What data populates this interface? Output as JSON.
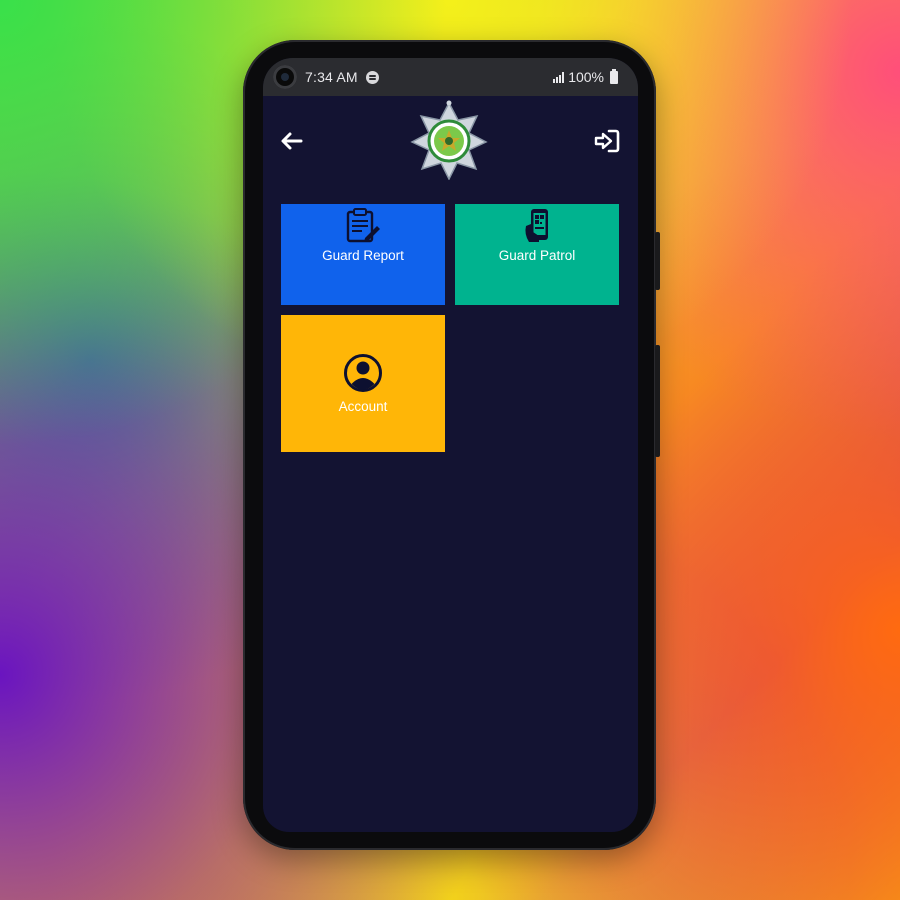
{
  "status_bar": {
    "time": "7:34 AM",
    "battery": "100%"
  },
  "app_bar": {
    "back_icon": "arrow-left-icon",
    "logo": "security-badge-logo",
    "logout_icon": "sign-in-icon"
  },
  "tiles": [
    {
      "label": "Guard Report",
      "icon": "clipboard-edit-icon",
      "color": "#1062ec"
    },
    {
      "label": "Guard Patrol",
      "icon": "qr-phone-scan-icon",
      "color": "#00b38f"
    },
    {
      "label": "Account",
      "icon": "user-circle-icon",
      "color": "#ffb607"
    }
  ],
  "colors": {
    "screen_background": "#131332",
    "status_bar": "#2b2c30"
  }
}
